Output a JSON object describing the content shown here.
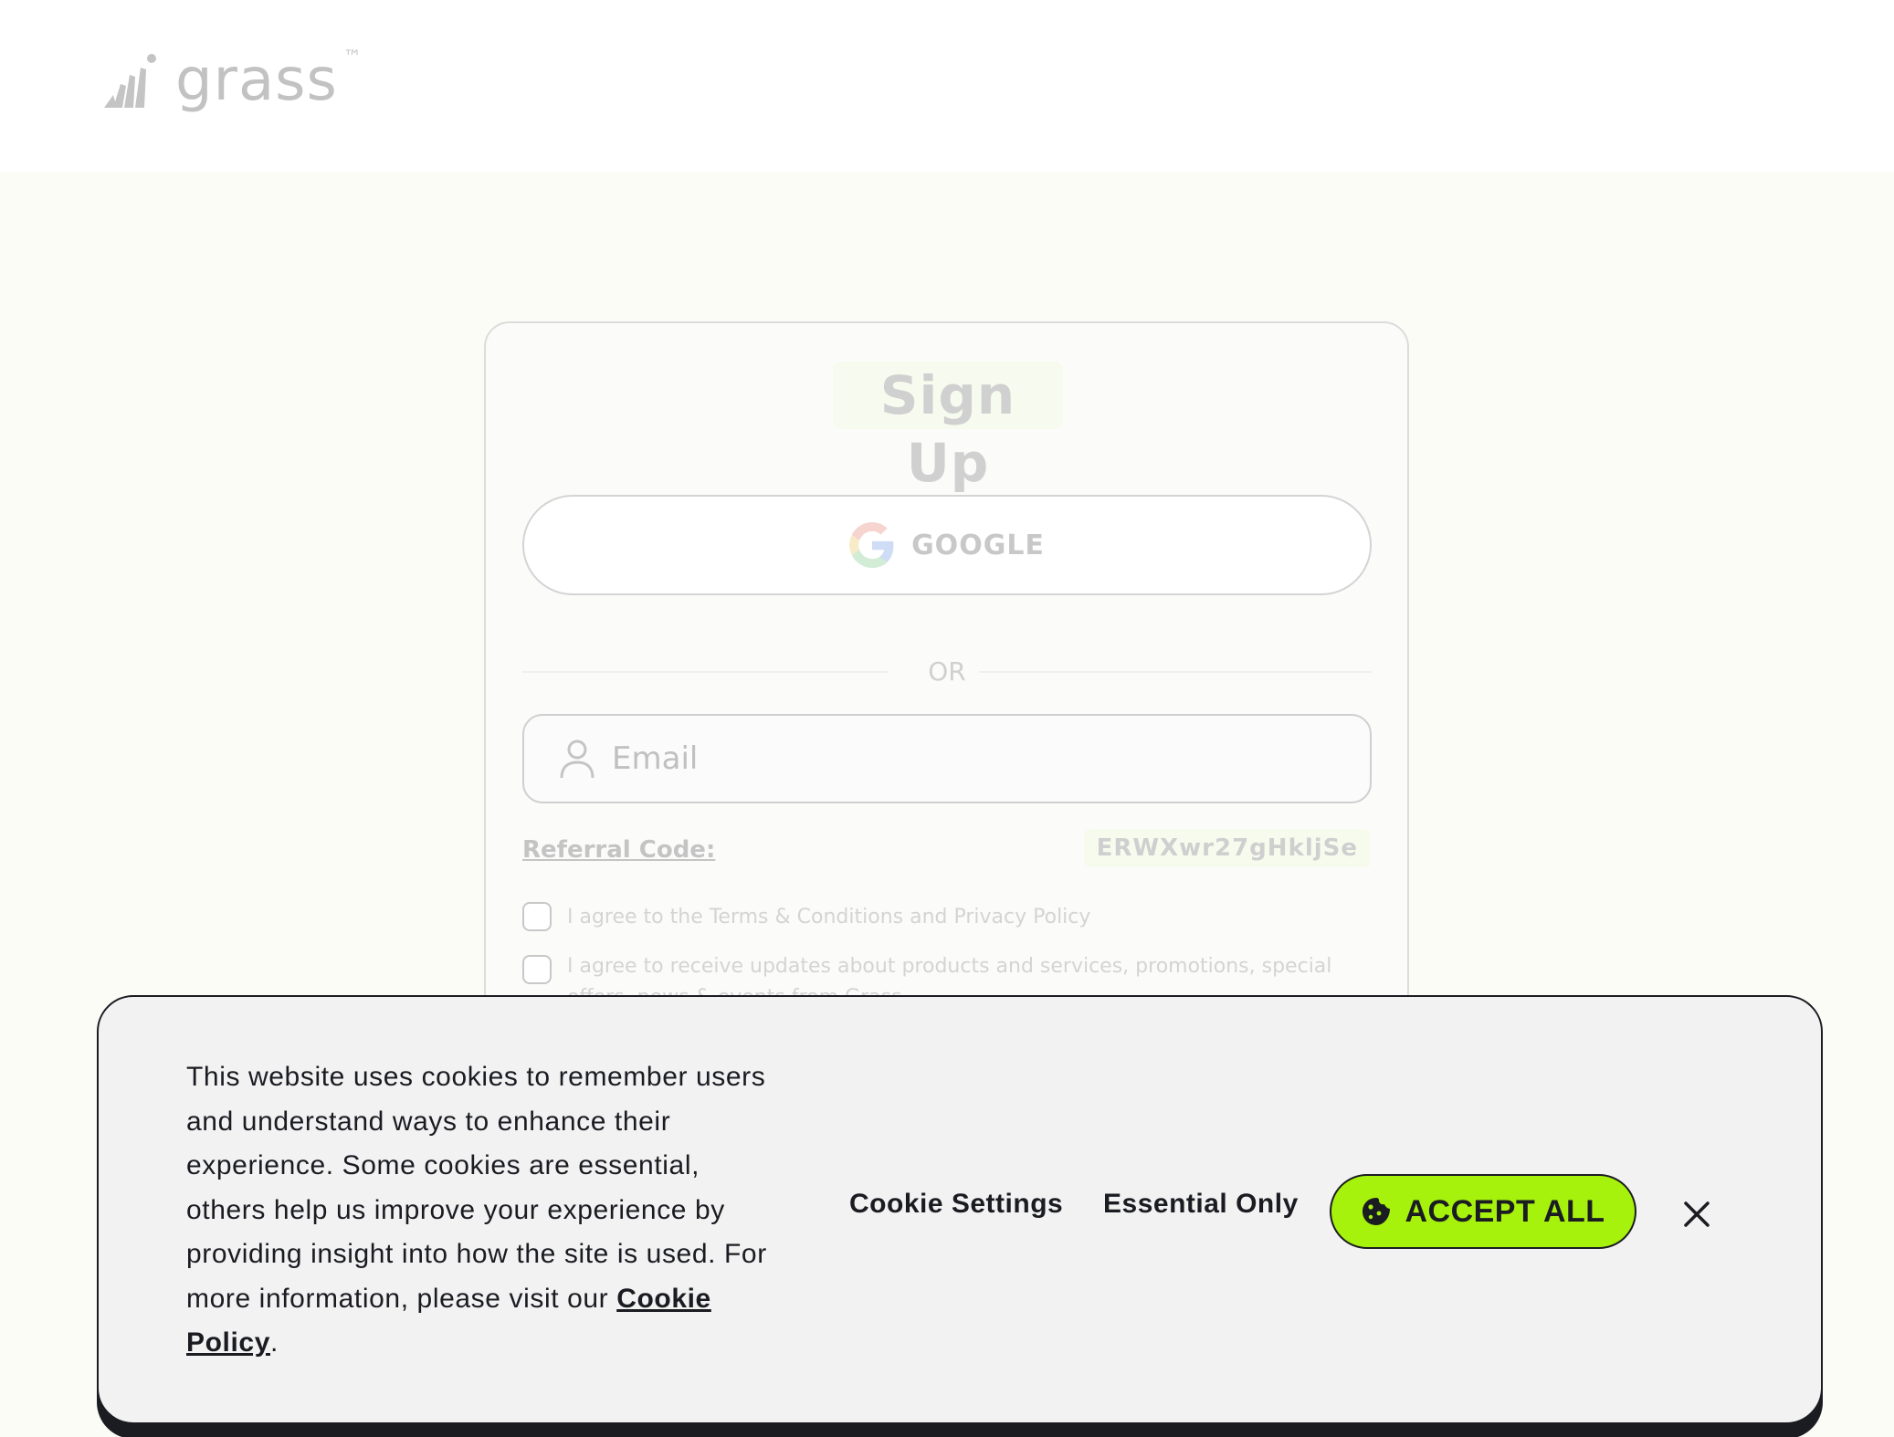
{
  "header": {
    "logo_text": "grass",
    "logo_tm": "™"
  },
  "signup": {
    "title": "Sign Up",
    "google_label": "GOOGLE",
    "divider_text": "OR",
    "email_placeholder": "Email",
    "referral_label": "Referral Code:",
    "referral_code": "ERWXwr27gHkljSe",
    "terms_text": "I agree to the Terms & Conditions and Privacy Policy",
    "updates_text": "I agree to receive updates about products and services, promotions, special offers, news & events from Grass."
  },
  "cookie_banner": {
    "message": "This website uses cookies to remember users and understand ways to enhance their experience. Some cookies are essential, others help us improve your experience by providing insight into how the site is used. For more information, please visit our ",
    "policy_link": "Cookie Policy",
    "message_end": ".",
    "settings_label": "Cookie Settings",
    "essential_label": "Essential Only",
    "accept_label": "ACCEPT ALL"
  },
  "icons": {
    "logo": "grass-logo-icon",
    "google": "google-icon",
    "user": "user-icon",
    "cookie": "cookie-icon",
    "close": "close-icon"
  },
  "colors": {
    "accent": "#a6f20c",
    "dark": "#1b1c22",
    "banner_bg": "#f2f2f2"
  }
}
